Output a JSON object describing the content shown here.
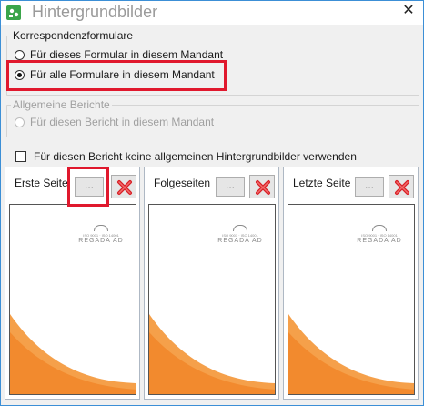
{
  "window": {
    "title": "Hintergrundbilder"
  },
  "correspondence": {
    "caption": "Korrespondenzformulare",
    "option_this_form": "Für dieses Formular in diesem Mandant",
    "option_all_forms": "Für alle Formulare in diesem Mandant",
    "selected": "all_forms"
  },
  "general_reports": {
    "caption": "Allgemeine Berichte",
    "option_this_report": "Für diesen Bericht in diesem Mandant"
  },
  "no_general_checkbox": {
    "label": "Für diesen Bericht keine allgemeinen Hintergrundbilder verwenden",
    "checked": false
  },
  "panels": [
    {
      "label": "Erste Seite",
      "browse_label": "..."
    },
    {
      "label": "Folgeseiten",
      "browse_label": "..."
    },
    {
      "label": "Letzte Seite",
      "browse_label": "..."
    }
  ],
  "logo": {
    "brand": "REGADA AD",
    "cert_left": "ISO 9001",
    "cert_right": "ISO 14001"
  },
  "colors": {
    "accent_highlight": "#e0182d",
    "orange": "#f5a04a",
    "delete_red": "#d81f26"
  }
}
